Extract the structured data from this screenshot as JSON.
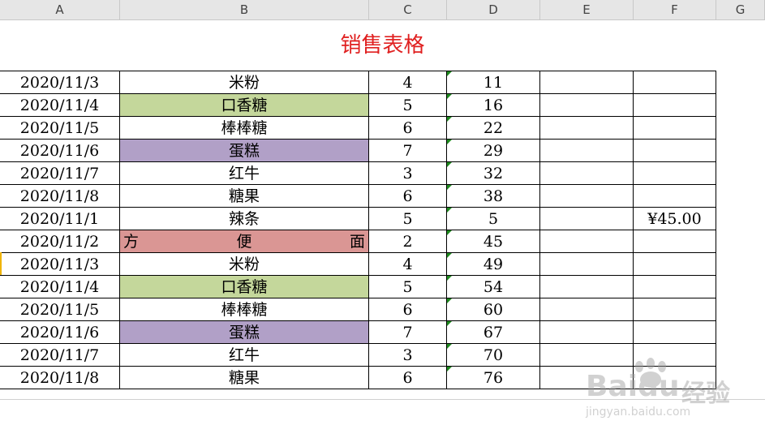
{
  "columns": [
    "A",
    "B",
    "C",
    "D",
    "E",
    "F",
    "G"
  ],
  "title": {
    "text": "销售表格",
    "color": "#e02020"
  },
  "colors": {
    "green": "#c4d79b",
    "purple": "#b1a0c7",
    "red": "#da9694",
    "triangle": "#1e8a1e"
  },
  "rows": [
    {
      "a": "2020/11/3",
      "b": "米粉",
      "c": "4",
      "d": "11",
      "f": "",
      "fill": ""
    },
    {
      "a": "2020/11/4",
      "b": "口香糖",
      "c": "5",
      "d": "16",
      "f": "",
      "fill": "green"
    },
    {
      "a": "2020/11/5",
      "b": "棒棒糖",
      "c": "6",
      "d": "22",
      "f": "",
      "fill": ""
    },
    {
      "a": "2020/11/6",
      "b": "蛋糕",
      "c": "7",
      "d": "29",
      "f": "",
      "fill": "purple"
    },
    {
      "a": "2020/11/7",
      "b": "红牛",
      "c": "3",
      "d": "32",
      "f": "",
      "fill": ""
    },
    {
      "a": "2020/11/8",
      "b": "糖果",
      "c": "6",
      "d": "38",
      "f": "",
      "fill": ""
    },
    {
      "a": "2020/11/1",
      "b": "辣条",
      "c": "5",
      "d": "5",
      "f": "¥45.00",
      "fill": ""
    },
    {
      "a": "2020/11/2",
      "b": "方便面",
      "c": "2",
      "d": "45",
      "f": "",
      "fill": "red"
    },
    {
      "a": "2020/11/3",
      "b": "米粉",
      "c": "4",
      "d": "49",
      "f": "",
      "fill": ""
    },
    {
      "a": "2020/11/4",
      "b": "口香糖",
      "c": "5",
      "d": "54",
      "f": "",
      "fill": "green"
    },
    {
      "a": "2020/11/5",
      "b": "棒棒糖",
      "c": "6",
      "d": "60",
      "f": "",
      "fill": ""
    },
    {
      "a": "2020/11/6",
      "b": "蛋糕",
      "c": "7",
      "d": "67",
      "f": "",
      "fill": "purple"
    },
    {
      "a": "2020/11/7",
      "b": "红牛",
      "c": "3",
      "d": "70",
      "f": "",
      "fill": ""
    },
    {
      "a": "2020/11/8",
      "b": "糖果",
      "c": "6",
      "d": "76",
      "f": "",
      "fill": ""
    }
  ],
  "watermark": {
    "brand": "Baidu",
    "brand_cn": "经验",
    "url": "jingyan.baidu.com"
  }
}
